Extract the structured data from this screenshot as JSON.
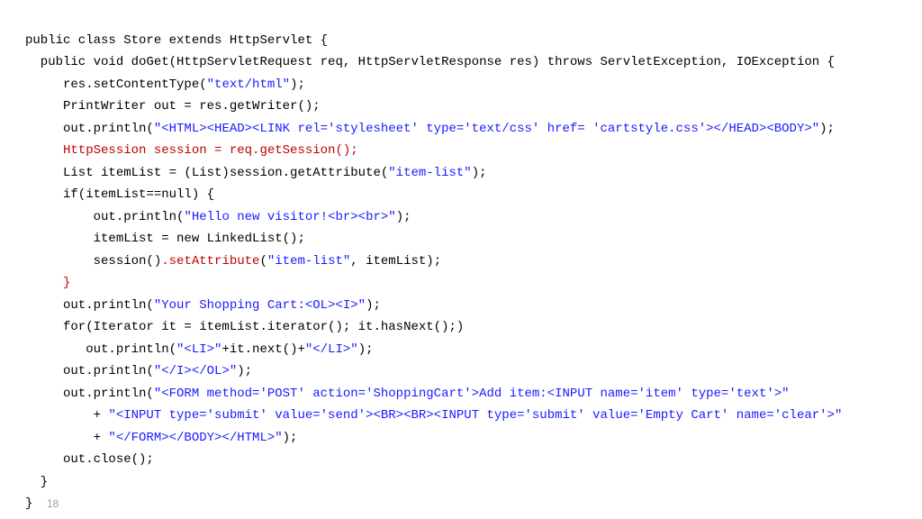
{
  "code": {
    "l01a": "public class Store extends HttpServlet {",
    "l02a": "  public void doGet(HttpServletRequest req, HttpServletResponse res) throws ServletException, IOException {",
    "l03a": "     res.setContentType(",
    "l03s": "\"text/html\"",
    "l03b": ");",
    "l04a": "     PrintWriter out = res.getWriter();",
    "l05a": "     out.println(",
    "l05s": "\"<HTML><HEAD><LINK rel='stylesheet' type='text/css' href= 'cartstyle.css'></HEAD><BODY>\"",
    "l05b": ");",
    "l06a": "     HttpSession session = req.getSession();",
    "l07a": "     List itemList = (List)session.getAttribute(",
    "l07s": "\"item-list\"",
    "l07b": ");",
    "l08a": "     if(itemList==null) {",
    "l09a": "         out.println(",
    "l09s": "\"Hello new visitor!<br><br>\"",
    "l09b": ");",
    "l10a": "         itemList = new LinkedList();",
    "l11a": "         session()",
    "l11r": ".setAttribute",
    "l11b": "(",
    "l11s": "\"item-list\"",
    "l11c": ", itemList);",
    "l12a": "     }",
    "l13a": "     out.println(",
    "l13s": "\"Your Shopping Cart:<OL><I>\"",
    "l13b": ");",
    "l14a": "     for(Iterator it = itemList.iterator(); it.hasNext();)",
    "l15a": "        out.println(",
    "l15s1": "\"<LI>\"",
    "l15m": "+it.next()+",
    "l15s2": "\"</LI>\"",
    "l15b": ");",
    "l16a": "     out.println(",
    "l16s": "\"</I></OL>\"",
    "l16b": ");",
    "l17a": "     out.println(",
    "l17s": "\"<FORM method='POST' action='ShoppingCart'>Add item:<INPUT name='item' type='text'>\"",
    "l18a": "         + ",
    "l18s": "\"<INPUT type='submit' value='send'><BR><BR><INPUT type='submit' value='Empty Cart' name='clear'>\"",
    "l19a": "         + ",
    "l19s": "\"</FORM></BODY></HTML>\"",
    "l19b": ");",
    "l20a": "     out.close();",
    "l21a": "  }",
    "l22a": "}"
  },
  "pageNumber": "18"
}
